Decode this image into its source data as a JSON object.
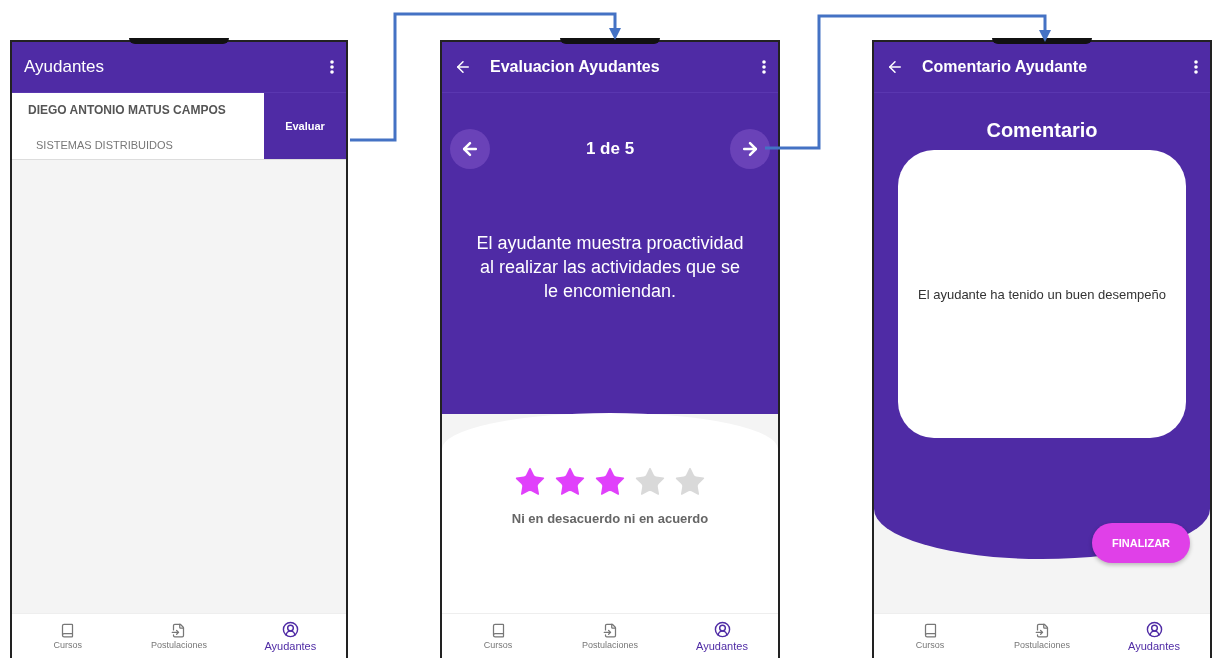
{
  "screens": [
    {
      "kind": "list",
      "title": "Ayudantes",
      "items": [
        {
          "name": "DIEGO ANTONIO MATUS CAMPOS",
          "course": "SISTEMAS DISTRIBUIDOS",
          "action": "Evaluar"
        }
      ],
      "nav": [
        {
          "label": "Cursos",
          "selected": false
        },
        {
          "label": "Postulaciones",
          "selected": false
        },
        {
          "label": "Ayudantes",
          "selected": true
        }
      ]
    },
    {
      "kind": "rating",
      "title": "Evaluacion Ayudantes",
      "counter": "1 de 5",
      "question": "El ayudante muestra proactividad al realizar las actividades que se le encomiendan.",
      "stars": 3,
      "rating_label": "Ni en desacuerdo ni en acuerdo",
      "nav": [
        {
          "label": "Cursos",
          "selected": false
        },
        {
          "label": "Postulaciones",
          "selected": false
        },
        {
          "label": "Ayudantes",
          "selected": true
        }
      ]
    },
    {
      "kind": "comment",
      "title": "Comentario Ayudante",
      "heading": "Comentario",
      "comment": "El ayudante ha tenido un buen desempeño",
      "button": "FINALIZAR",
      "nav": [
        {
          "label": "Cursos",
          "selected": false
        },
        {
          "label": "Postulaciones",
          "selected": false
        },
        {
          "label": "Ayudantes",
          "selected": true
        }
      ]
    }
  ]
}
